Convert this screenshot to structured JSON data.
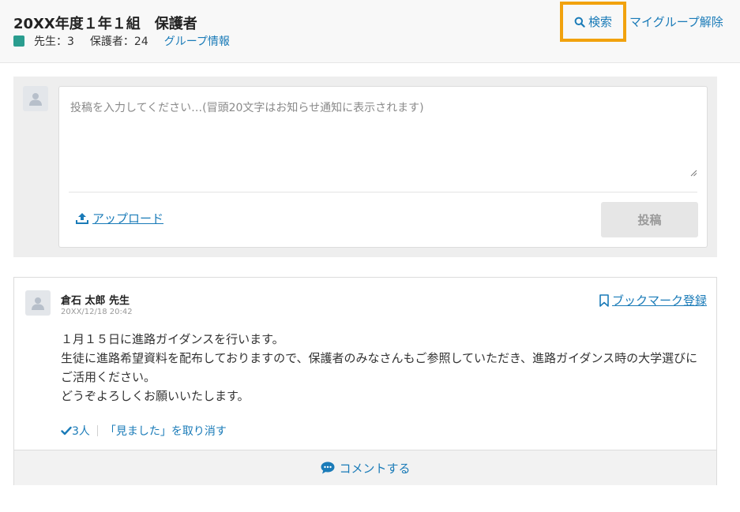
{
  "header": {
    "title": "20XX年度１年１組　保護者",
    "teacher_count": "先生：3",
    "guardian_count": "保護者：24",
    "group_info_link": "グループ情報",
    "search_label": "検索",
    "unregister_label": "マイグループ解除",
    "group_color": "#2a9d8f"
  },
  "composer": {
    "placeholder": "投稿を入力してください…(冒頭20文字はお知らせ通知に表示されます)",
    "upload_label": "アップロード",
    "post_button": "投稿"
  },
  "post": {
    "author": "倉石 太郎 先生",
    "timestamp": "20XX/12/18 20:42",
    "bookmark_label": "ブックマーク登録",
    "body": [
      "１月１５日に進路ガイダンスを行います。",
      "生徒に進路希望資料を配布しておりますので、保護者のみなさんもご参照していただき、進路ガイダンス時の大学選びにご活用ください。",
      "どうぞよろしくお願いいたします。"
    ],
    "seen_count": "3人",
    "undo_seen": "「見ました」を取り消す",
    "comment_label": "コメントする"
  },
  "icons": {
    "search": "search-icon",
    "upload": "upload-icon",
    "bookmark": "bookmark-icon",
    "check": "check-icon",
    "comment": "comment-icon",
    "avatar": "user-avatar-icon"
  },
  "colors": {
    "link": "#1a7bb8",
    "highlight": "#f1a20e"
  }
}
